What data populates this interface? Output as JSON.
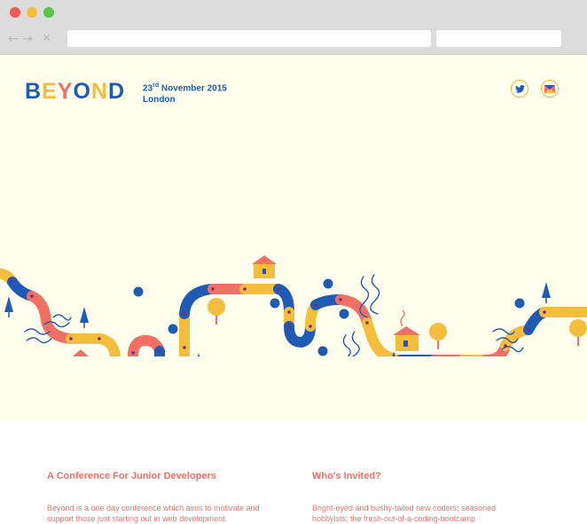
{
  "browser": {
    "controls": {
      "close_color": "#f05b58",
      "minimize_color": "#f5bd3c",
      "maximize_color": "#56c548"
    },
    "nav": {
      "back_icon": "←",
      "forward_icon": "→",
      "close_icon": "✕"
    },
    "address_bar": {
      "value": ""
    },
    "search_bar": {
      "value": ""
    }
  },
  "header": {
    "logo_letters": [
      "B",
      "E",
      "Y",
      "O",
      "N",
      "D"
    ],
    "logo_colors": [
      "#1f5bb5",
      "#f5bd3c",
      "#f07065",
      "#1f5bb5",
      "#f5bd3c",
      "#1f5bb5"
    ],
    "date_day": "23",
    "date_suffix": "rd",
    "date_rest": " November 2015",
    "location": "London",
    "twitter_icon": "twitter-icon",
    "email_icon": "email-icon"
  },
  "colors": {
    "blue": "#1f5bb5",
    "yellow": "#f5bd3c",
    "coral": "#f07065",
    "cream": "#fefeed"
  },
  "content": {
    "left": {
      "title": "A Conference For Junior Developers",
      "text": "Beyond is a one day conference which aims to motivate and support those just starting out in web development."
    },
    "right": {
      "title": "Who's Invited?",
      "text": "Bright-eyed and bushy-tailed new coders; seasoned hobbyists; the fresh-out-of-a-coding-bootcamp"
    }
  }
}
